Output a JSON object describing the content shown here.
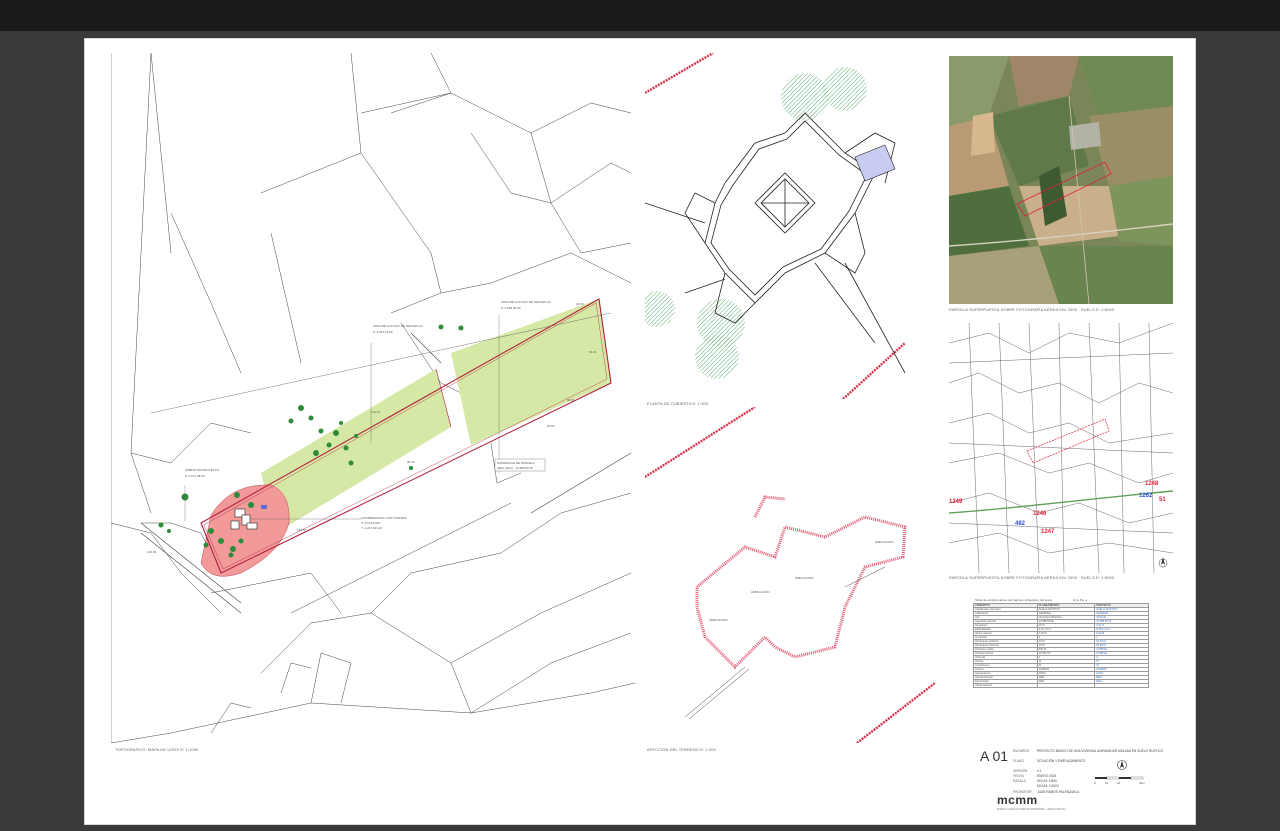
{
  "colors": {
    "background": "#3a3a3a",
    "topbar": "#1b1b1b",
    "sheet": "#ffffff",
    "field_green": "#d6e8a6",
    "area_red": "#f29a9a",
    "boundary": "#b0203a",
    "tree_green": "#2e8b3a"
  },
  "icons": [
    "north-arrow-icon",
    "scale-bar-icon"
  ],
  "captions": {
    "site_plan": "TOPOGRAFICO: MAPA DE USOS E: 1:1000",
    "roof_plan": "PLANTA DE CUBIERTA E: 1:200",
    "terrain": "AFECCIÓN DEL TERRENO E: 1:200",
    "aerial": "PARCELA SUPERPUESTA SOBRE FOTOGRAFÍA AÉREA IGU 2000 · SUELO E: 1:5000",
    "cadastre": "PARCELA SUPERPUESTA SOBRE FOTOGRAFÍA AÉREA IGU 2000 · SUELO E: 1:5000"
  },
  "site_labels": {
    "zone_1": "ZONA DE CULTIVO DE SECANO (1)",
    "zone_1_area": "S: 4.827,12 M²",
    "zone_2": "ZONA DE CULTIVO DE SECANO (2)",
    "zone_2_area": "S: 4.865,46 M²",
    "plot": "SUPERFICIE DE PARCELA",
    "plot_area": "(REC GRU) : 12.985,50 M²",
    "project_area": "ÁMBITO DE PROYECTO",
    "project_area_value": "S: 2.271,38 M²",
    "coords": "COORDENADAS UTM VIVIENDA",
    "coord_x": "X: 273.213,80",
    "coord_y": "Y: 4.247.191,20",
    "dim_1": "126.84",
    "dim_2": "129.87",
    "dim_3": "110.32",
    "dim_4": "98.44",
    "dim_5": "32.65",
    "dim_6": "50.21",
    "dim_7": "20.94",
    "dim_8": "32.56"
  },
  "terrain_labels": [
    "AMPLIACIÓN",
    "AMPLIACIÓN",
    "AMPLIACIÓN",
    "AMPLIACIÓN"
  ],
  "cadastre_labels": [
    "1248",
    "1249",
    "1246",
    "482",
    "1247",
    "1262",
    "51"
  ],
  "params_table": {
    "title": "Tabla de condicionantes del régimen urbanístico del suelo",
    "page": "(1) a   Pe: a",
    "header": [
      "CONCEPTO",
      "PLANEAMIENTO",
      "PROYECTO"
    ],
    "rows": [
      [
        "Clasificación del suelo",
        "SUELO RÚSTICO",
        "SUELO RÚSTICO"
      ],
      [
        "Calificación",
        "GENERAL",
        "GENERAL"
      ],
      [
        "Uso",
        "Vivienda Unifamiliar",
        "Vivienda"
      ],
      [
        "Superficie parcela",
        "12.985,50 M²",
        "12.985,50 M²"
      ],
      [
        "Ocupación",
        "10 %",
        "2,41 %"
      ],
      [
        "Edificabilidad",
        "0,10 m²/m²",
        "0,024 m²/m²"
      ],
      [
        "Altura máxima",
        "7,00 M",
        "5,40 M"
      ],
      [
        "Nº plantas",
        "2",
        "1"
      ],
      [
        "Retranqueo linderos",
        "10 M",
        "32,65 M"
      ],
      [
        "Retranqueo caminos",
        "15 M",
        "20,94 M"
      ],
      [
        "Distancia núcleo",
        "500 M",
        "CUMPLE"
      ],
      [
        "Parcela mínima",
        "10.000 M²",
        "CUMPLE"
      ],
      [
        "Vivienda",
        "1",
        "1"
      ],
      [
        "Piscina",
        "SÍ",
        "SÍ"
      ],
      [
        "Cerramiento",
        "SÍ",
        "SÍ"
      ],
      [
        "Acceso",
        "CAMINO",
        "CAMINO"
      ],
      [
        "Saneamiento",
        "FOSA",
        "FOSA"
      ],
      [
        "Abastecimiento",
        "RED",
        "RED"
      ],
      [
        "Electricidad",
        "RED",
        "RED"
      ],
      [
        "Observaciones",
        "",
        ""
      ]
    ]
  },
  "title_block": {
    "sheet_number": "A 01",
    "encargo_label": "ENCARGO",
    "encargo": "PROYECTO BÁSICO DE UNA VIVIENDA UNIFAMILIAR AISLADA EN SUELO RÚSTICO",
    "plano_label": "PLANO",
    "plano": "SITUACIÓN Y EMPLAZAMIENTO",
    "version_label": "VERSIÓN",
    "version": "0.1",
    "fecha_label": "FECHA",
    "fecha": "ENERO 2024",
    "escala_label": "ESCALA",
    "escala_1": "DIN A3: 1/500",
    "escala_2": "DIN A3: 1/1000",
    "promotor_label": "PROMOTOR",
    "promotor": "JUAN RAMOS PALENZUELA",
    "scale_ticks": [
      "0",
      "10",
      "20",
      "30m"
    ],
    "logo": "mcmm",
    "logo_sub": "MARIO CARLOS MARTÍN MARTÍNEZ · ARQUITECTO"
  }
}
